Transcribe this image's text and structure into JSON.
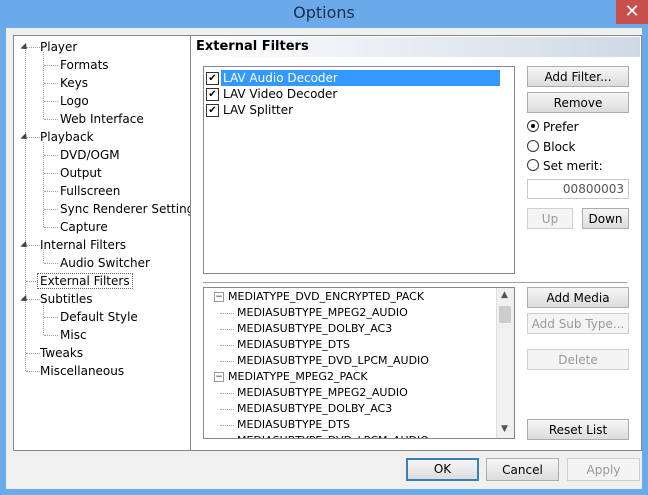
{
  "window": {
    "title": "Options",
    "close_glyph": "✕"
  },
  "tree": {
    "items": [
      {
        "label": "Player",
        "level": 0,
        "expanded": true
      },
      {
        "label": "Formats",
        "level": 1
      },
      {
        "label": "Keys",
        "level": 1
      },
      {
        "label": "Logo",
        "level": 1
      },
      {
        "label": "Web Interface",
        "level": 1
      },
      {
        "label": "Playback",
        "level": 0,
        "expanded": true
      },
      {
        "label": "DVD/OGM",
        "level": 1
      },
      {
        "label": "Output",
        "level": 1
      },
      {
        "label": "Fullscreen",
        "level": 1
      },
      {
        "label": "Sync Renderer Settings",
        "level": 1
      },
      {
        "label": "Capture",
        "level": 1
      },
      {
        "label": "Internal Filters",
        "level": 0,
        "expanded": true
      },
      {
        "label": "Audio Switcher",
        "level": 1
      },
      {
        "label": "External Filters",
        "level": 0,
        "selected": true
      },
      {
        "label": "Subtitles",
        "level": 0,
        "expanded": true
      },
      {
        "label": "Default Style",
        "level": 1
      },
      {
        "label": "Misc",
        "level": 1
      },
      {
        "label": "Tweaks",
        "level": 0
      },
      {
        "label": "Miscellaneous",
        "level": 0
      }
    ]
  },
  "panel": {
    "header": "External Filters",
    "filters": [
      {
        "label": "LAV Audio Decoder",
        "checked": true,
        "selected": true
      },
      {
        "label": "LAV Video Decoder",
        "checked": true
      },
      {
        "label": "LAV Splitter",
        "checked": true
      }
    ],
    "buttons": {
      "add_filter": "Add Filter...",
      "remove": "Remove",
      "up": "Up",
      "down": "Down",
      "add_media_type": "Add Media Type...",
      "add_sub_type": "Add Sub Type...",
      "delete": "Delete",
      "reset_list": "Reset List"
    },
    "radios": {
      "prefer": "Prefer",
      "block": "Block",
      "set_merit": "Set merit:",
      "selected": "prefer"
    },
    "merit_value": "00800003",
    "media_types": [
      {
        "label": "MEDIATYPE_DVD_ENCRYPTED_PACK",
        "level": 0
      },
      {
        "label": "MEDIASUBTYPE_MPEG2_AUDIO",
        "level": 1
      },
      {
        "label": "MEDIASUBTYPE_DOLBY_AC3",
        "level": 1
      },
      {
        "label": "MEDIASUBTYPE_DTS",
        "level": 1
      },
      {
        "label": "MEDIASUBTYPE_DVD_LPCM_AUDIO",
        "level": 1
      },
      {
        "label": "MEDIATYPE_MPEG2_PACK",
        "level": 0
      },
      {
        "label": "MEDIASUBTYPE_MPEG2_AUDIO",
        "level": 1
      },
      {
        "label": "MEDIASUBTYPE_DOLBY_AC3",
        "level": 1
      },
      {
        "label": "MEDIASUBTYPE_DTS",
        "level": 1
      },
      {
        "label": "MEDIASUBTYPE_DVD_LPCM_AUDIO",
        "level": 1
      }
    ]
  },
  "footer": {
    "ok": "OK",
    "cancel": "Cancel",
    "apply": "Apply"
  }
}
